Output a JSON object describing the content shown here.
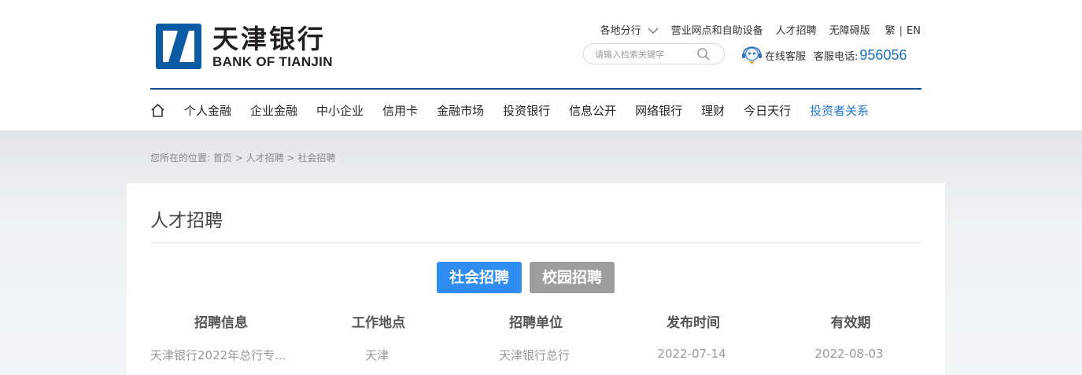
{
  "brand": {
    "name_cn": "天津银行",
    "name_en": "BANK OF TIANJIN",
    "logo_color": "#0a5aa4"
  },
  "toplinks": {
    "branches": "各地分行",
    "outlets": "营业网点和自助设备",
    "careers": "人才招聘",
    "accessible": "无障碍版",
    "lang_tc": "繁",
    "lang_sep": "|",
    "lang_en": "EN"
  },
  "search": {
    "placeholder": "请输入检索关键字",
    "icon": "search-icon"
  },
  "service": {
    "online": "在线客服",
    "hotline_label": "客服电话:",
    "hotline": "956056"
  },
  "nav": {
    "home_icon": "home-icon",
    "items": [
      "个人金融",
      "企业金融",
      "中小企业",
      "信用卡",
      "金融市场",
      "投资银行",
      "信息公开",
      "网络银行",
      "理财",
      "今日天行",
      "投资者关系"
    ],
    "active_color": "#1f78d1"
  },
  "breadcrumb": {
    "prefix": "您所在的位置:",
    "home": "首页",
    "sep": ">",
    "careers": "人才招聘",
    "current": "社会招聘"
  },
  "page": {
    "title": "人才招聘",
    "tabs": [
      {
        "label": "社会招聘",
        "active": true
      },
      {
        "label": "校园招聘",
        "active": false
      }
    ]
  },
  "table": {
    "headers": [
      "招聘信息",
      "工作地点",
      "招聘单位",
      "发布时间",
      "有效期"
    ],
    "rows": [
      [
        "天津银行2022年总行专...",
        "天津",
        "天津银行总行",
        "2022-07-14",
        "2022-08-03"
      ]
    ]
  }
}
